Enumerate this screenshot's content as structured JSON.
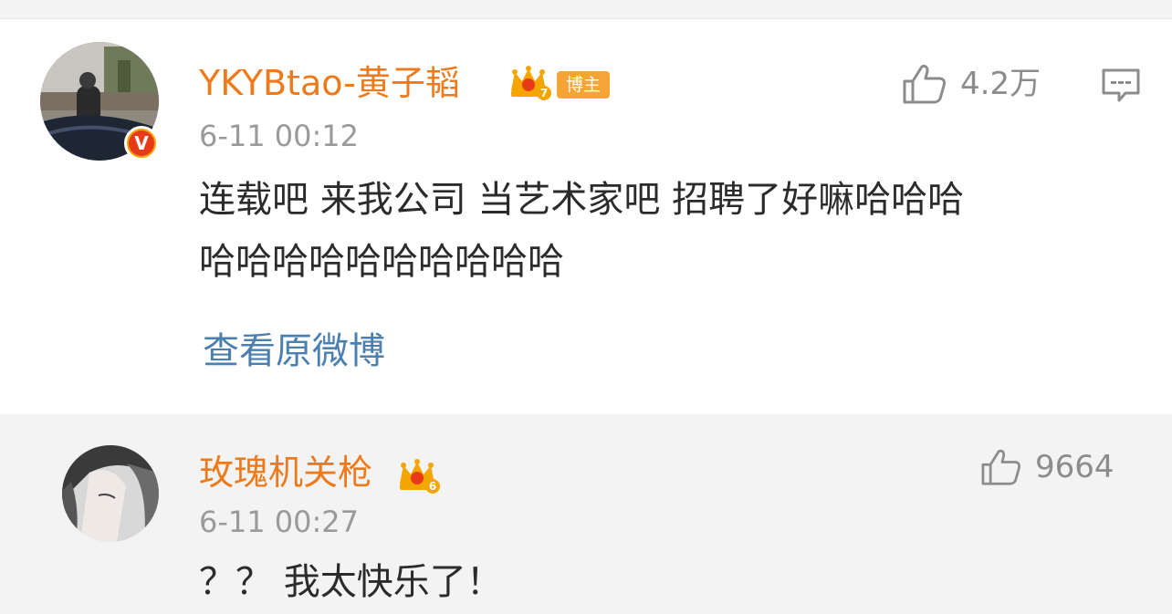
{
  "comments": [
    {
      "username": "YKYBtao-黄子韬",
      "verified_mark": "V",
      "crown_level": "7",
      "badge": "博主",
      "timestamp": "6-11 00:12",
      "text_line_1": "连载吧 来我公司 当艺术家吧 招聘了好嘛哈哈哈",
      "text_line_2": "哈哈哈哈哈哈哈哈哈哈",
      "view_original": "查看原微博",
      "likes": "4.2万",
      "icons": [
        "thumbs-up-icon",
        "comment-reply-icon",
        "crown-icon"
      ]
    },
    {
      "username": "玫瑰机关枪",
      "crown_level": "6",
      "timestamp": "6-11 00:27",
      "text": "？？ 我太快乐了！",
      "likes": "9664",
      "icons": [
        "thumbs-up-icon",
        "crown-icon"
      ]
    }
  ],
  "colors": {
    "username": "#ee7a1b",
    "link": "#4a7fb0",
    "timestamp": "#9a9a9a",
    "badge": "#f6a436",
    "verified": "#e63a18"
  }
}
